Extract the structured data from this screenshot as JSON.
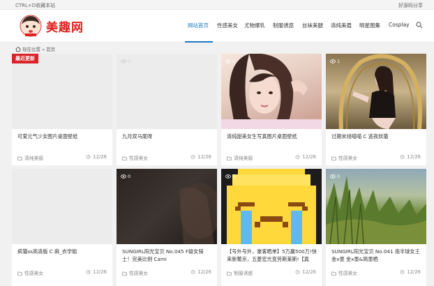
{
  "topbar": {
    "left_text": "CTRL+D收藏本站",
    "right_text": "好源码分享"
  },
  "logo": {
    "text": "美趣网"
  },
  "nav": {
    "items": [
      "网站首页",
      "性感美女",
      "尤物爆乳",
      "制服诱惑",
      "丝袜美腿",
      "清纯美眉",
      "明星图集",
      "Cosplay"
    ],
    "active_index": 0
  },
  "breadcrumb": {
    "current_label": "现在位置",
    "separator": "»",
    "home": "首页"
  },
  "badge": {
    "label": "最近更新"
  },
  "cards": [
    {
      "views": "",
      "title": "可爱元气少女图片桌面壁纸",
      "category": "清纯美眉",
      "date": "12/26",
      "image": "blank"
    },
    {
      "views": "",
      "title": "九月双马尾呀",
      "category": "性感美女",
      "date": "12/26",
      "image": "blank"
    },
    {
      "views": "0",
      "title": "清纯甜美女生写真图片桌面壁纸",
      "category": "清纯美眉",
      "date": "12/26",
      "image": "portrait"
    },
    {
      "views": "1",
      "title": "过期米线喵喵 C 逃夜妖猫",
      "category": "性感美女",
      "date": "12/26",
      "image": "gold"
    },
    {
      "views": "",
      "title": "疯猫ss高清版 C 麻_衣学姐",
      "category": "性感美女",
      "date": "12/26",
      "image": "blank"
    },
    {
      "views": "0",
      "title": "SUNGIRL阳光宝贝 No.045 F级女骑士！完美比例 Cami",
      "category": "性感美女",
      "date": "12/26",
      "image": "dark"
    },
    {
      "views": "0",
      "title": "【号外号外，豪客晒单】5万赢500万!快来新葡京，五菱宏光变劳斯莱斯!【真",
      "category": "制服诱惑",
      "date": "12/26",
      "image": "emoji"
    },
    {
      "views": "0",
      "title": "SUNGIRL阳光宝贝 No.041 南半球女王金x墨 金x墨&简墨栖",
      "category": "性感美女",
      "date": "12/26",
      "image": "grass"
    }
  ],
  "colors": {
    "accent": "#1a78c2",
    "badge": "#d9242a",
    "logo": "#e02020"
  },
  "icons": {
    "search": "search-icon",
    "home": "home-icon",
    "views": "eye-icon",
    "category": "folder-icon",
    "date": "clock-icon"
  }
}
